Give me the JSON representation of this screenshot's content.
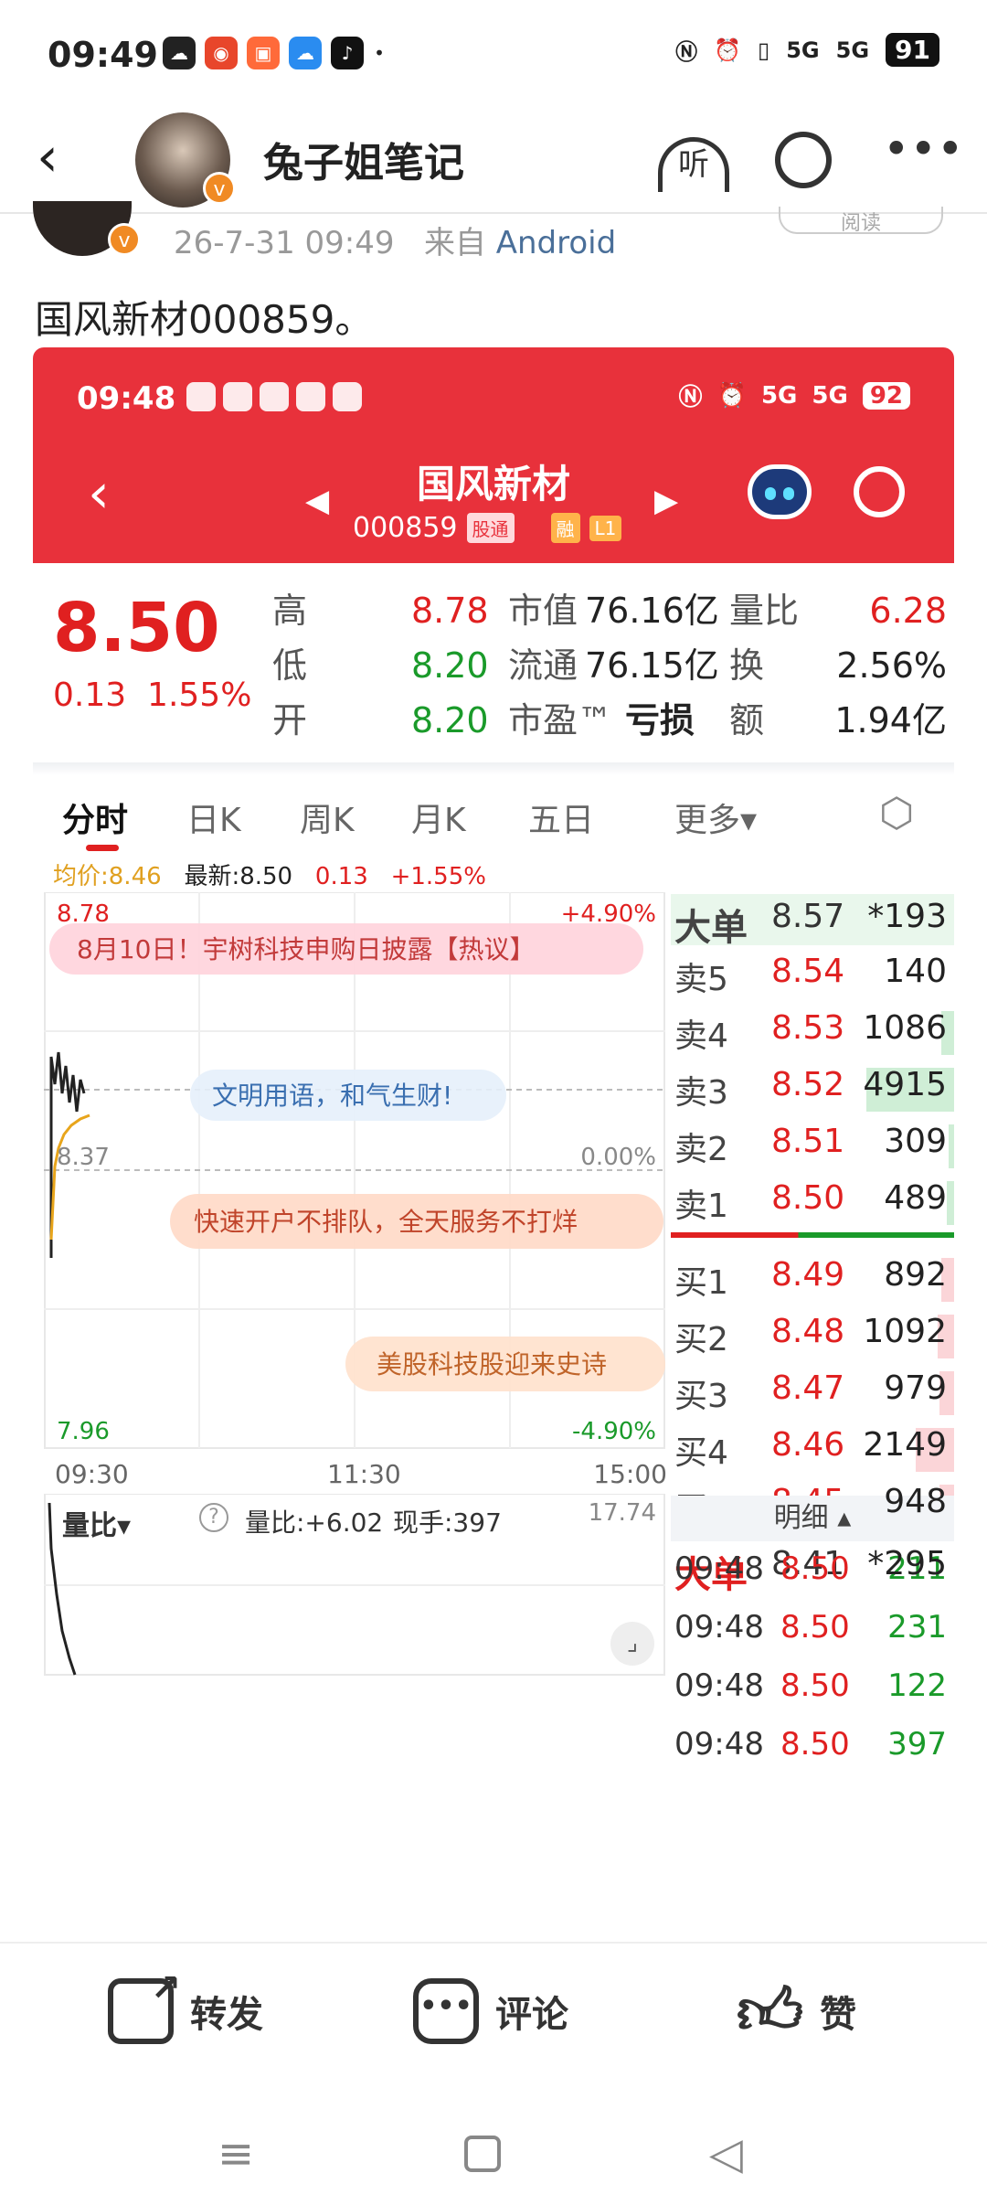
{
  "status_bar": {
    "time": "09:49",
    "battery": "91",
    "signal_1": "5G",
    "signal_2": "5G"
  },
  "header": {
    "username": "兔子姐笔记",
    "listen_label": "听"
  },
  "post": {
    "meta_date": "26-7-31 09:49",
    "meta_from": "来自",
    "meta_source": "Android",
    "read_label": "阅读",
    "text": "国风新材000859。"
  },
  "screenshot": {
    "status_time": "09:48",
    "battery": "92",
    "stock_name": "国风新材",
    "stock_code": "000859",
    "tag1": "股通",
    "tag2": "融",
    "tag3": "L1",
    "price": "8.50",
    "change": "0.13",
    "change_pct": "1.55%",
    "quote": {
      "high_label": "高",
      "high": "8.78",
      "low_label": "低",
      "low": "8.20",
      "open_label": "开",
      "open": "8.20",
      "mcap_label": "市值",
      "mcap": "76.16亿",
      "float_label": "流通",
      "float": "76.15亿",
      "pe_label": "市盈™",
      "pe": "亏损",
      "vr_label": "量比",
      "vr": "6.28",
      "turn_label": "换",
      "turn": "2.56%",
      "amt_label": "额",
      "amt": "1.94亿"
    },
    "tabs": [
      "分时",
      "日K",
      "周K",
      "月K",
      "五日",
      "更多▾"
    ],
    "info": {
      "avg": "均价:8.46",
      "latest": "最新:8.50",
      "chg": "0.13",
      "pct": "+1.55%"
    },
    "chart_labels": {
      "top_price": "8.78",
      "top_pct": "+4.90%",
      "mid_price": "8.37",
      "mid_pct": "0.00%",
      "bot_price": "7.96",
      "bot_pct": "-4.90%",
      "t_start": "09:30",
      "t_mid": "11:30",
      "t_end": "15:00"
    },
    "banners": [
      "8月10日！宇树科技申购日披露【热议】",
      "文明用语，和气生财!",
      "快速开户不排队，全天服务不打烊",
      "美股科技股迎来史诗"
    ],
    "big_order_label": "大单",
    "big_sell": {
      "price": "8.57",
      "vol": "*193"
    },
    "sells": [
      {
        "label": "卖5",
        "price": "8.54",
        "vol": "140"
      },
      {
        "label": "卖4",
        "price": "8.53",
        "vol": "1086"
      },
      {
        "label": "卖3",
        "price": "8.52",
        "vol": "4915"
      },
      {
        "label": "卖2",
        "price": "8.51",
        "vol": "309"
      },
      {
        "label": "卖1",
        "price": "8.50",
        "vol": "489"
      }
    ],
    "buys": [
      {
        "label": "买1",
        "price": "8.49",
        "vol": "892"
      },
      {
        "label": "买2",
        "price": "8.48",
        "vol": "1092"
      },
      {
        "label": "买3",
        "price": "8.47",
        "vol": "979"
      },
      {
        "label": "买4",
        "price": "8.46",
        "vol": "2149"
      },
      {
        "label": "买5",
        "price": "8.45",
        "vol": "948"
      }
    ],
    "big_buy": {
      "price": "8.41",
      "vol": "*295"
    },
    "volume_panel": {
      "label": "量比▾",
      "ratio": "量比:+6.02",
      "now": "现手:397",
      "max": "17.74"
    },
    "detail_label": "明细 ▴",
    "details": [
      {
        "time": "09:48",
        "price": "8.50",
        "vol": "211"
      },
      {
        "time": "09:48",
        "price": "8.50",
        "vol": "231"
      },
      {
        "time": "09:48",
        "price": "8.50",
        "vol": "122"
      },
      {
        "time": "09:48",
        "price": "8.50",
        "vol": "397"
      }
    ]
  },
  "actions": {
    "repost": "转发",
    "comment": "评论",
    "like": "赞"
  },
  "colors": {
    "accent_red": "#e8313b",
    "up": "#e02020",
    "down": "#1a9a2a"
  }
}
